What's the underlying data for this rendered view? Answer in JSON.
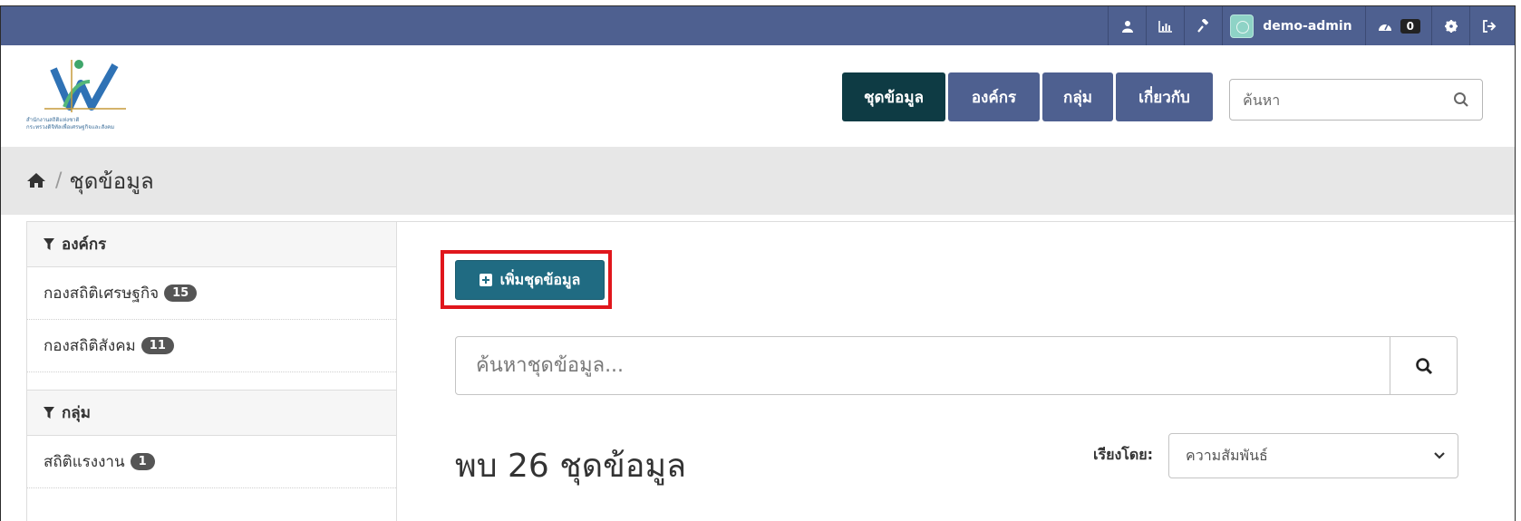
{
  "account_bar": {
    "username": "demo-admin",
    "activity_count": "0"
  },
  "logo": {
    "line1": "สำนักงานสถิติแห่งชาติ",
    "line2": "กระทรวงดิจิทัลเพื่อเศรษฐกิจและสังคม"
  },
  "nav": {
    "items": [
      "ชุดข้อมูล",
      "องค์กร",
      "กลุ่ม",
      "เกี่ยวกับ"
    ]
  },
  "site_search": {
    "placeholder": "ค้นหา"
  },
  "breadcrumb": {
    "current": "ชุดข้อมูล"
  },
  "sidebar": {
    "organizations": {
      "heading": "องค์กร",
      "items": [
        {
          "label": "กองสถิติเศรษฐกิจ",
          "count": "15"
        },
        {
          "label": "กองสถิติสังคม",
          "count": "11"
        }
      ]
    },
    "groups": {
      "heading": "กลุ่ม",
      "items": [
        {
          "label": "สถิติแรงงาน",
          "count": "1"
        }
      ]
    }
  },
  "main": {
    "add_dataset_label": "เพิ่มชุดข้อมูล",
    "search_placeholder": "ค้นหาชุดข้อมูล...",
    "result_text": "พบ 26 ชุดข้อมูล",
    "sort_label": "เรียงโดย:",
    "sort_value": "ความสัมพันธ์"
  },
  "colors": {
    "account_bar": "#4e6090",
    "nav_button": "#4e6090",
    "nav_active": "#0e3b44",
    "primary_button": "#206b82",
    "highlight_box": "#e0161c"
  }
}
